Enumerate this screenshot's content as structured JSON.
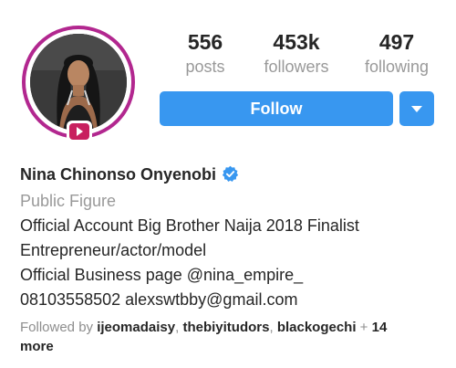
{
  "avatar": {
    "ring_color": "#b2278f",
    "badge_icon": "igtv-play-icon",
    "badge_color": "#c8205f"
  },
  "stats": [
    {
      "value": "556",
      "label": "posts"
    },
    {
      "value": "453k",
      "label": "followers"
    },
    {
      "value": "497",
      "label": "following"
    }
  ],
  "actions": {
    "follow_label": "Follow",
    "accent_color": "#3897f0",
    "dropdown_icon": "caret-down-icon"
  },
  "profile": {
    "name": "Nina Chinonso Onyenobi",
    "verified_icon": "verified-badge-icon",
    "category": "Public Figure",
    "bio_lines": [
      "Official Account Big Brother Naija 2018 Finalist",
      "Entrepreneur/actor/model",
      "Official Business page @nina_empire_",
      "08103558502 alexswtbby@gmail.com"
    ]
  },
  "followed_by": {
    "prefix": "Followed by",
    "accounts": [
      "ijeomadaisy",
      "thebiyitudors",
      "blackogechi"
    ],
    "separator": ", ",
    "plus_text": " + ",
    "more_count": "14",
    "more_word": "more"
  }
}
